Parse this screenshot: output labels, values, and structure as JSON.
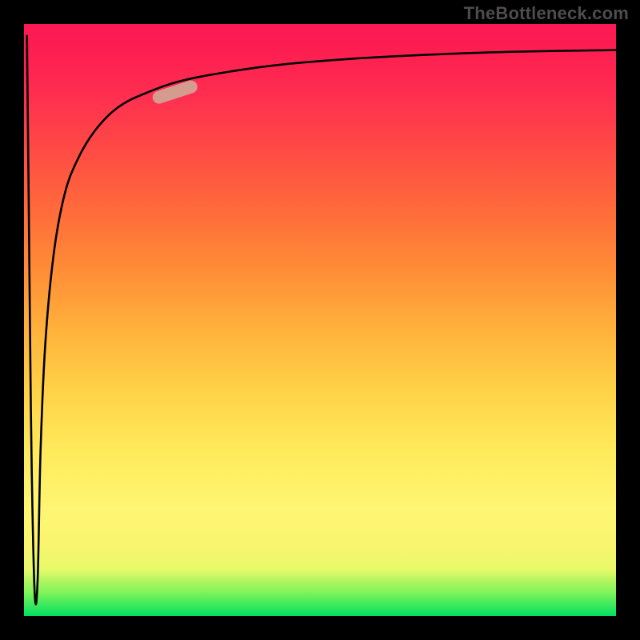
{
  "watermark": "TheBottleneck.com",
  "chart_data": {
    "type": "line",
    "title": "",
    "xlabel": "",
    "ylabel": "",
    "xlim": [
      0,
      100
    ],
    "ylim": [
      0,
      100
    ],
    "series": [
      {
        "name": "curve",
        "x": [
          0.5,
          0.8,
          1.0,
          1.3,
          1.8,
          2.3,
          2.8,
          3.6,
          5.0,
          6.8,
          9.0,
          12.0,
          16.0,
          21.0,
          27.0,
          35.0,
          44.0,
          55.0,
          68.0,
          82.0,
          100.0
        ],
        "values": [
          98,
          70,
          50,
          25,
          4,
          6,
          28,
          46,
          61,
          71,
          77,
          82,
          86,
          88.5,
          90.5,
          92,
          93.2,
          94.1,
          94.8,
          95.3,
          95.6
        ]
      }
    ],
    "marker": {
      "x_pct": 25.5,
      "y_pct": 88.5,
      "angle_deg": -18
    },
    "background_gradient": {
      "top": "#fc1854",
      "mid": "#ffd247",
      "bottom": "#00e060"
    }
  }
}
